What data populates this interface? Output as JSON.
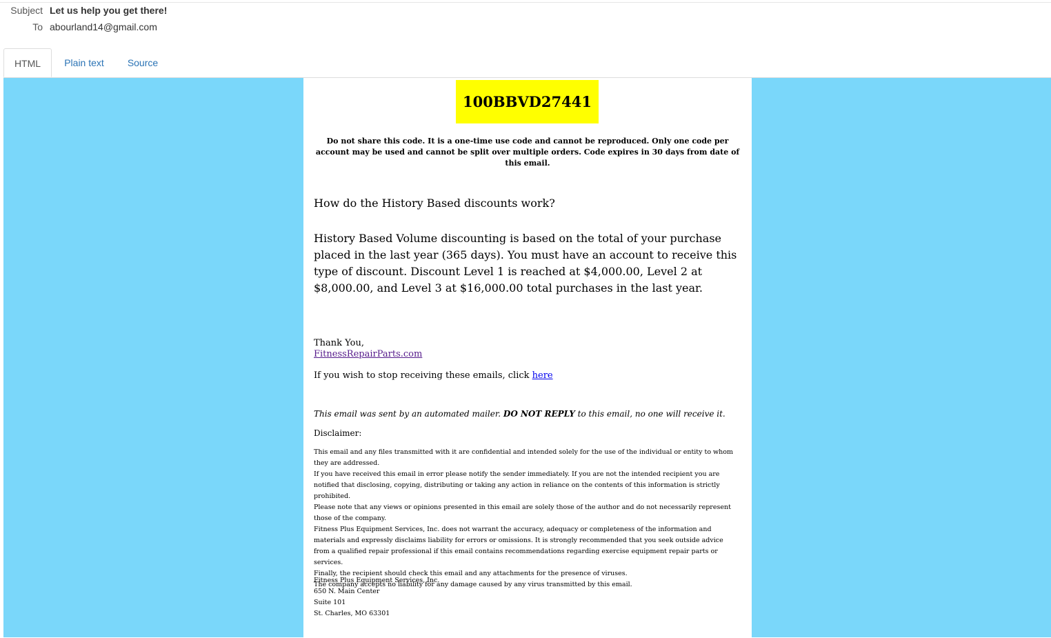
{
  "header": {
    "subject_label": "Subject",
    "subject_value": "Let us help you get there!",
    "to_label": "To",
    "to_value": "abourland14@gmail.com"
  },
  "tabs": [
    {
      "label": "HTML",
      "active": true
    },
    {
      "label": "Plain text",
      "active": false
    },
    {
      "label": "Source",
      "active": false
    }
  ],
  "colors": {
    "frame_background": "#7ad7fa",
    "code_background": "#ffff00",
    "tab_link": "#2a73b5"
  },
  "email": {
    "code": "100BBVD27441",
    "code_note": "Do not share this code. It is a one-time use code and cannot be reproduced. Only one code per account may be used and cannot be split over multiple orders. Code expires in 30 days from date of this email.",
    "question": "How do the History Based discounts work?",
    "paragraph": "History Based Volume discounting is based on the total of your purchase placed in the last year (365 days). You must have an account to receive this type of discount. Discount Level 1 is reached at $4,000.00, Level 2 at $8,000.00, and Level 3 at $16,000.00 total purchases in the last year.",
    "thanks": "Thank You,",
    "site_link": "FitnessRepairParts.com",
    "unsubscribe_text": "If you wish to stop receiving these emails, click ",
    "unsubscribe_link": "here",
    "auto_note_prefix": "This email was sent by an automated mailer. ",
    "auto_note_bold": "DO NOT REPLY",
    "auto_note_suffix": " to this email, no one will receive it.",
    "disclaimer_title": "Disclaimer:",
    "disclaimer_lines": [
      "This email and any files transmitted with it are confidential and intended solely for the use of the individual or entity to whom they are addressed.",
      "If you have received this email in error please notify the sender immediately. If you are not the intended recipient you are notified that disclosing, copying, distributing or taking any action in reliance on the contents of this information is strictly prohibited.",
      "Please note that any views or opinions presented in this email are solely those of the author and do not necessarily represent those of the company.",
      "Fitness Plus Equipment Services, Inc. does not warrant the accuracy, adequacy or completeness of the information and materials and expressly disclaims liability for errors or omissions. It is strongly recommended that you seek outside advice from a qualified repair professional if this email contains recommendations regarding exercise equipment repair parts or services.",
      "Finally, the recipient should check this email and any attachments for the presence of viruses.",
      "The company accepts no liability for any damage caused by any virus transmitted by this email."
    ],
    "address": {
      "company": "Fitness Plus Equipment Services, Inc.",
      "street": "650 N. Main Center",
      "suite": "Suite 101",
      "city": "St. Charles, MO 63301"
    }
  }
}
